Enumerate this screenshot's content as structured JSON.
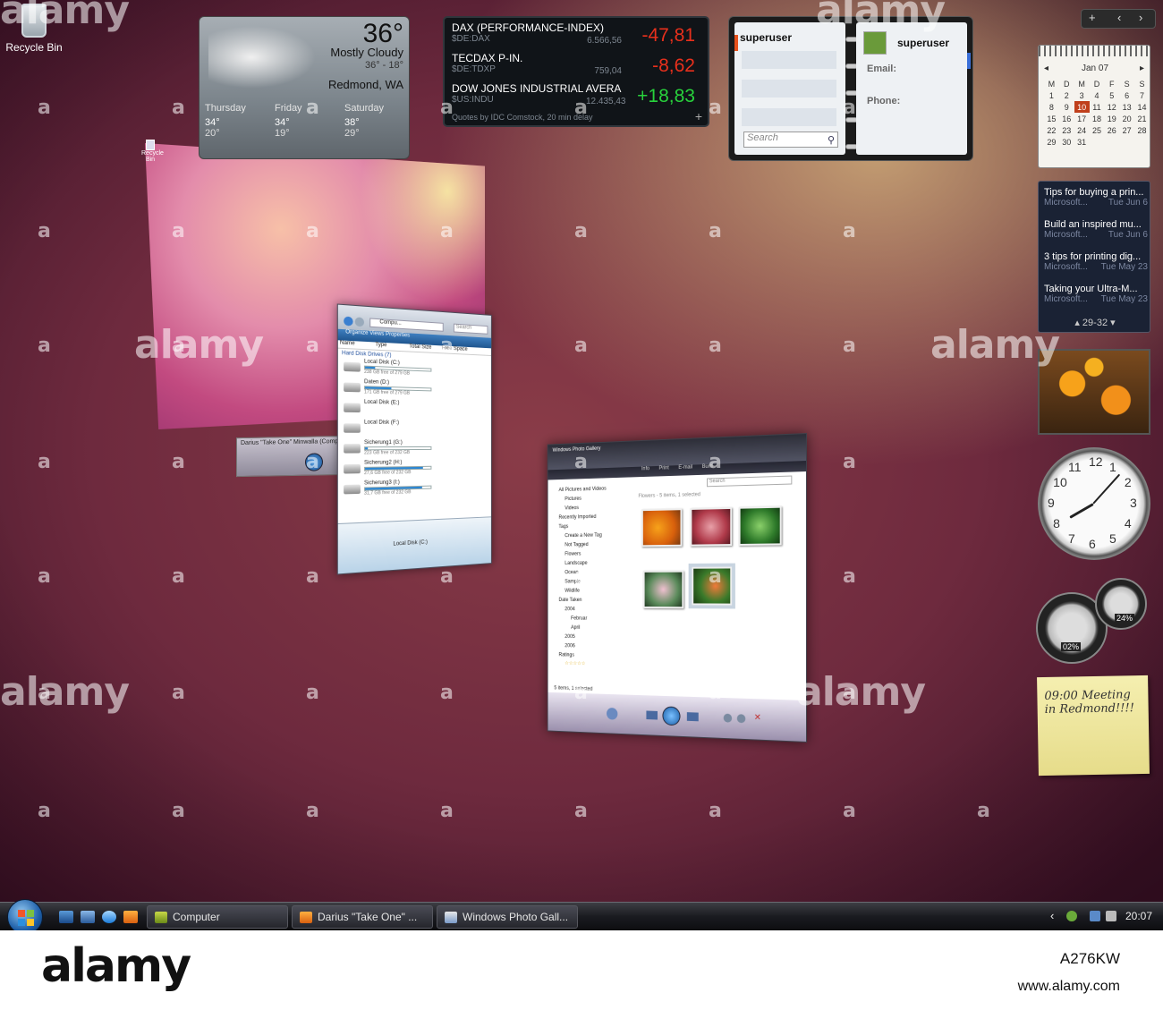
{
  "desktop": {
    "recycle_bin_label": "Recycle Bin",
    "mini_icon_label": "Recycle Bin"
  },
  "weather": {
    "temp": "36°",
    "condition": "Mostly Cloudy",
    "range": "36° - 18°",
    "city": "Redmond, WA",
    "forecast": [
      {
        "day": "Thursday",
        "high": "34°",
        "low": "20°"
      },
      {
        "day": "Friday",
        "high": "34°",
        "low": "19°"
      },
      {
        "day": "Saturday",
        "high": "38°",
        "low": "29°"
      }
    ]
  },
  "stocks": {
    "items": [
      {
        "name": "DAX (PERFORMANCE-INDEX)",
        "symbol": "$DE:DAX",
        "price": "6.566,56",
        "change": "-47,81"
      },
      {
        "name": "TECDAX P-IN.",
        "symbol": "$DE:TDXP",
        "price": "759,04",
        "change": "-8,62"
      },
      {
        "name": "DOW JONES INDUSTRIAL AVERA...",
        "symbol": "$US:INDU",
        "price": "12.435,43",
        "change": "+18,83"
      }
    ],
    "footer": "Quotes by IDC Comstock, 20 min delay",
    "colors": {
      "down": "#e8301c",
      "up": "#28d23c"
    }
  },
  "contacts": {
    "user_left": "superuser",
    "user_right": "superuser",
    "search_placeholder": "Search",
    "email_label": "Email:",
    "phone_label": "Phone:"
  },
  "calendar": {
    "month": "Jan 07",
    "weekdays": [
      "M",
      "D",
      "M",
      "D",
      "F",
      "S",
      "S"
    ],
    "weeks": [
      [
        "",
        "1",
        "2",
        "3",
        "4",
        "5",
        "6",
        "7"
      ],
      [
        "",
        "8",
        "9",
        "10",
        "11",
        "12",
        "13",
        "14"
      ],
      [
        "",
        "15",
        "16",
        "17",
        "18",
        "19",
        "20",
        "21"
      ],
      [
        "",
        "22",
        "23",
        "24",
        "25",
        "26",
        "27",
        "28"
      ],
      [
        "",
        "29",
        "30",
        "31",
        "",
        "",
        "",
        ""
      ]
    ],
    "today": "10"
  },
  "news": {
    "items": [
      {
        "title": "Tips for buying a prin...",
        "source": "Microsoft...",
        "date": "Tue Jun 6"
      },
      {
        "title": "Build an inspired mu...",
        "source": "Microsoft...",
        "date": "Tue Jun 6"
      },
      {
        "title": "3 tips for printing dig...",
        "source": "Microsoft...",
        "date": "Tue May 23"
      },
      {
        "title": "Taking your Ultra-M...",
        "source": "Microsoft...",
        "date": "Tue May 23"
      }
    ],
    "pager": "29-32"
  },
  "clock": {
    "numbers": [
      "12",
      "1",
      "2",
      "3",
      "4",
      "5",
      "6",
      "7",
      "8",
      "9",
      "10",
      "11"
    ],
    "time": "20:07"
  },
  "meter": {
    "cpu": "02%",
    "memory": "24%"
  },
  "note": {
    "text": "09:00 Meeting in Redmond!!!!"
  },
  "player": {
    "title": "Darius \"Take One\" Minwalla (Composer)"
  },
  "explorer": {
    "address": "Compu...",
    "search": "Search",
    "command_bar": "Organize    Views    Properties",
    "columns": [
      "Name",
      "Type",
      "Total Size",
      "Free Space"
    ],
    "group": "Hard Disk Drives (7)",
    "drives": [
      {
        "name": "Local Disk (C:)",
        "free": "238 GB free of 279 GB",
        "fill": 0.15
      },
      {
        "name": "Daten (D:)",
        "free": "171 GB free of 279 GB",
        "fill": 0.39
      },
      {
        "name": "Local Disk (E:)",
        "free": "",
        "fill": 0
      },
      {
        "name": "Local Disk (F:)",
        "free": "",
        "fill": 0
      },
      {
        "name": "Sicherung1 (G:)",
        "free": "223 GB free of 232 GB",
        "fill": 0.04
      },
      {
        "name": "Sicherung2 (H:)",
        "free": "27,6 GB free of 232 GB",
        "fill": 0.88
      },
      {
        "name": "Sicherung3 (I:)",
        "free": "31,7 GB free of 232 GB",
        "fill": 0.86
      }
    ],
    "details_label": "Local Disk (C:)"
  },
  "photo": {
    "title": "Windows Photo Gallery",
    "menu": [
      "Info",
      "Print",
      "E-mail",
      "Burn"
    ],
    "search": "Search",
    "header": "Flowers - 5 items, 1 selected",
    "tree": [
      "All Pictures and Videos",
      "Pictures",
      "Videos",
      "Recently Imported",
      "Tags",
      "Create a New Tag",
      "Not Tagged",
      "Flowers",
      "Landscape",
      "Ocean",
      "Sample",
      "Wildlife",
      "Date Taken",
      "2004",
      "Februar",
      "April",
      "2005",
      "2006",
      "Ratings"
    ],
    "status": "5 items, 1 selected"
  },
  "taskbar": {
    "tasks": [
      "Computer",
      "Darius \"Take One\" ...",
      "Windows Photo Gall..."
    ],
    "time": "20:07"
  },
  "watermark": {
    "brand": "alamy",
    "image_id": "A276KW",
    "url": "www.alamy.com"
  }
}
